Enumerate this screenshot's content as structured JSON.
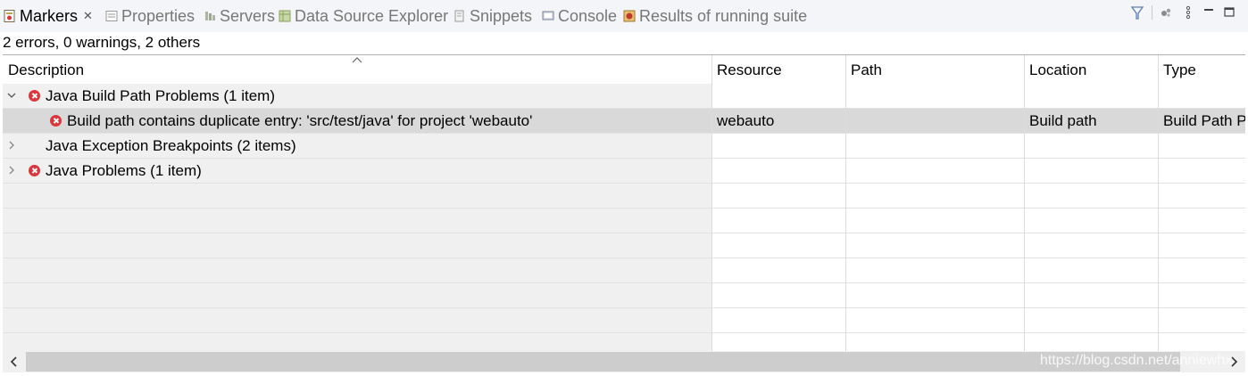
{
  "tabs": [
    {
      "label": "Markers",
      "icon": "markers-icon",
      "active": true,
      "closable": true
    },
    {
      "label": "Properties",
      "icon": "properties-icon",
      "active": false
    },
    {
      "label": "Servers",
      "icon": "servers-icon",
      "active": false
    },
    {
      "label": "Data Source Explorer",
      "icon": "data-source-icon",
      "active": false
    },
    {
      "label": "Snippets",
      "icon": "snippets-icon",
      "active": false
    },
    {
      "label": "Console",
      "icon": "console-icon",
      "active": false
    },
    {
      "label": "Results of running suite",
      "icon": "testng-results-icon",
      "active": false
    }
  ],
  "tab_close_glyph": "✕",
  "view_toolbar": [
    "filter-icon",
    "focus-icon",
    "view-menu-icon",
    "minimize-icon",
    "maximize-icon"
  ],
  "status": "2 errors, 0 warnings, 2 others",
  "columns": {
    "description": "Description",
    "resource": "Resource",
    "path": "Path",
    "location": "Location",
    "type": "Type"
  },
  "rows": [
    {
      "description": "Java Build Path Problems (1 item)",
      "resource": "",
      "path": "",
      "location": "",
      "type": ""
    },
    {
      "description": "Build path contains duplicate entry: 'src/test/java' for project 'webauto'",
      "resource": "webauto",
      "path": "",
      "location": "Build path",
      "type": "Build Path P"
    },
    {
      "description": "Java Exception Breakpoints (2 items)",
      "resource": "",
      "path": "",
      "location": "",
      "type": ""
    },
    {
      "description": "Java Problems (1 item)",
      "resource": "",
      "path": "",
      "location": "",
      "type": ""
    }
  ],
  "watermark": "https://blog.csdn.net/anniewhx",
  "colors": {
    "error": "#d9363e",
    "selection": "#d9d9d9",
    "tab_bg": "#f4f5f8"
  }
}
